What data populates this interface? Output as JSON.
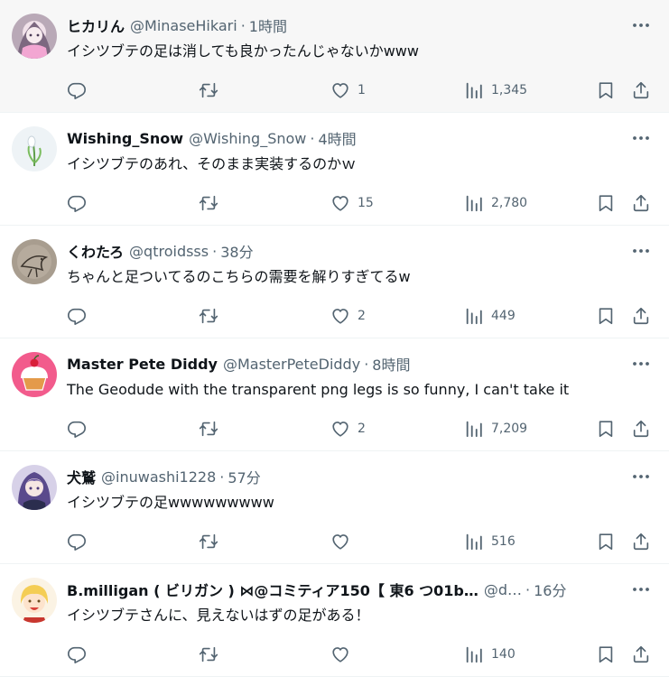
{
  "posts": [
    {
      "name": "ヒカリん",
      "handle": "@MinaseHikari",
      "time": "1時間",
      "text": "イシツブテの足は消しても良かったんじゃないかwww",
      "likes": "1",
      "views": "1,345",
      "avatar": "anime-girl-avatar",
      "highlighted": true
    },
    {
      "name": "Wishing_Snow",
      "handle": "@Wishing_Snow",
      "time": "4時間",
      "text": "イシツブテのあれ、そのまま実装するのかｗ",
      "likes": "15",
      "views": "2,780",
      "avatar": "snowdrop-flower-avatar"
    },
    {
      "name": "くわたろ",
      "handle": "@qtroidsss",
      "time": "38分",
      "text": "ちゃんと足ついてるのこちらの需要を解りすぎてるw",
      "likes": "2",
      "views": "449",
      "avatar": "bird-sketch-avatar"
    },
    {
      "name": "Master Pete Diddy",
      "handle": "@MasterPeteDiddy",
      "time": "8時間",
      "text": "The Geodude with the transparent png legs is so funny, I can't take it",
      "likes": "2",
      "views": "7,209",
      "avatar": "cupcake-avatar"
    },
    {
      "name": "犬鷲",
      "handle": "@inuwashi1228",
      "time": "57分",
      "text": "イシツブテの足wwwwwwwww",
      "likes": "",
      "views": "516",
      "avatar": "purple-hair-anime-avatar"
    },
    {
      "name": "B.milligan ( ビリガン ) ⋈@コミティア150【 東6 つ01b…",
      "handle": "@d…",
      "time": "16分",
      "text": "イシツブテさんに、見えないはずの足がある！",
      "likes": "",
      "views": "140",
      "avatar": "blonde-anime-avatar"
    }
  ],
  "separator": "·",
  "icons": {
    "reply": "reply-icon",
    "repost": "repost-icon",
    "like": "heart-icon",
    "views": "views-chart-icon",
    "bookmark": "bookmark-icon",
    "share": "share-icon",
    "more": "more-dots-icon"
  },
  "colors": {
    "text": "#0f1419",
    "secondary": "#536471",
    "divider": "#eff3f4",
    "hover": "#f7f7f7"
  }
}
